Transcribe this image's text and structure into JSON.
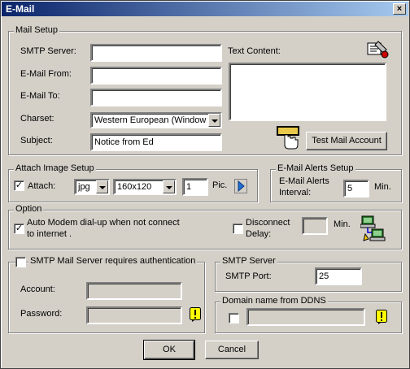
{
  "window": {
    "title": "E-Mail",
    "close_glyph": "×"
  },
  "mail_setup": {
    "legend": "Mail Setup",
    "smtp_server_label": "SMTP Server:",
    "smtp_server_value": "",
    "email_from_label": "E-Mail From:",
    "email_from_value": "",
    "email_to_label": "E-Mail To:",
    "email_to_value": "",
    "charset_label": "Charset:",
    "charset_value": "Western European (Windows",
    "subject_label": "Subject:",
    "subject_value": "Notice from Ed",
    "text_content_label": "Text Content:",
    "text_content_value": "",
    "test_button": "Test Mail Account",
    "icons": [
      "address-book-icon",
      "test-mail-hand-icon"
    ]
  },
  "attach_image": {
    "legend": "Attach Image Setup",
    "attach_label": "Attach:",
    "attach_checked": true,
    "format_value": "jpg",
    "size_value": "160x120",
    "count_value": "1",
    "pic_label": "Pic.",
    "icons": [
      "play-arrow-icon"
    ]
  },
  "alerts": {
    "legend": "E-Mail Alerts Setup",
    "interval_label_1": "E-Mail Alerts",
    "interval_label_2": "Interval:",
    "interval_value": "5",
    "unit": "Min."
  },
  "option": {
    "legend": "Option",
    "modem_label_1": "Auto Modem dial-up when not connect",
    "modem_label_2": "to internet .",
    "modem_checked": true,
    "disconnect_label_1": "Disconnect",
    "disconnect_label_2": "Delay:",
    "disconnect_checked": false,
    "delay_value": "",
    "unit": "Min.",
    "icons": [
      "network-computers-icon"
    ]
  },
  "auth": {
    "legend": "SMTP Mail Server requires authentication",
    "checked": false,
    "account_label": "Account:",
    "account_value": "",
    "password_label": "Password:",
    "password_value": "",
    "icons": [
      "warning-icon"
    ]
  },
  "smtp_server": {
    "legend": "SMTP Server",
    "port_label": "SMTP Port:",
    "port_value": "25"
  },
  "ddns": {
    "legend": "Domain name from DDNS",
    "checked": false,
    "value": "",
    "icons": [
      "warning-icon"
    ]
  },
  "buttons": {
    "ok": "OK",
    "cancel": "Cancel"
  },
  "colors": {
    "title_start": "#0a246a",
    "title_end": "#a6caf0",
    "face": "#d4d0c8",
    "warning": "#ffff00"
  }
}
